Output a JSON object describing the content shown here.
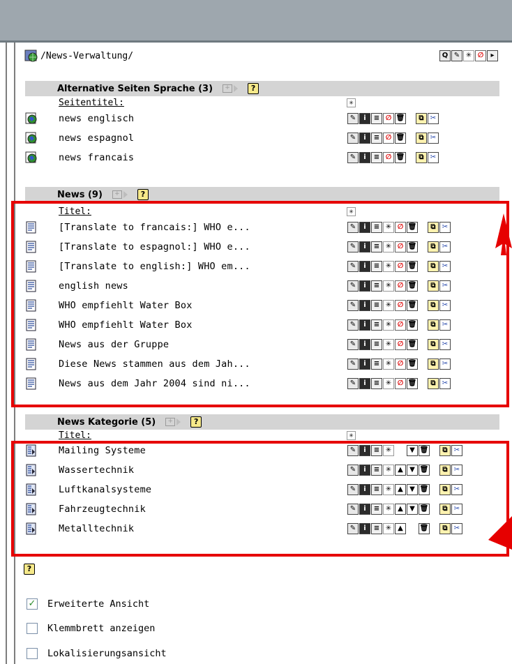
{
  "header": {
    "path": "/News-Verwaltung/"
  },
  "sections": [
    {
      "title": "Alternative Seiten Sprache (3)",
      "column": "Seitentitel:",
      "rows": [
        "news englisch",
        "news espagnol",
        "news francais"
      ]
    },
    {
      "title": "News (9)",
      "column": "Titel:",
      "rows": [
        "[Translate to francais:] WHO e...",
        "[Translate to espagnol:] WHO e...",
        "[Translate to english:] WHO em...",
        "english news",
        "WHO empfiehlt Water Box",
        "WHO empfiehlt Water Box",
        "News aus der Gruppe",
        "Diese News stammen aus dem Jah...",
        "News aus dem Jahr 2004 sind ni..."
      ]
    },
    {
      "title": "News Kategorie (5)",
      "column": "Titel:",
      "rows": [
        "Mailing Systeme",
        "Wassertechnik",
        "Luftkanalsysteme",
        "Fahrzeugtechnik",
        "Metalltechnik"
      ]
    }
  ],
  "options": [
    {
      "label": "Erweiterte Ansicht",
      "checked": true
    },
    {
      "label": "Klemmbrett anzeigen",
      "checked": false
    },
    {
      "label": "Lokalisierungsansicht",
      "checked": false
    }
  ],
  "colors": {
    "highlight": "#e60000",
    "section_header": "#d4d4d4",
    "topbar": "#9ea7ae"
  },
  "help_glyph": "?"
}
